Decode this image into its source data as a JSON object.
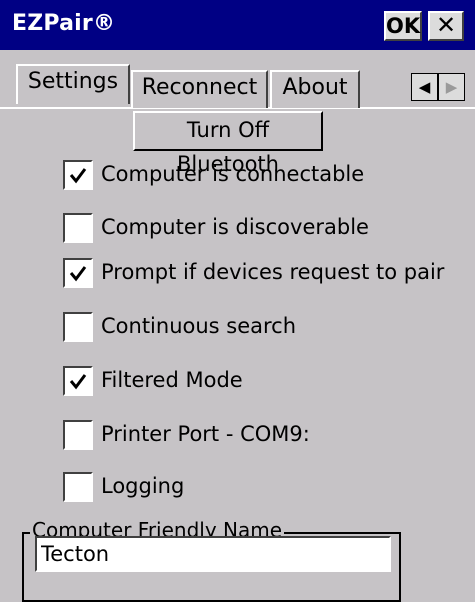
{
  "window": {
    "title": "EZPair®",
    "ok_label": "OK",
    "close_label": "✕"
  },
  "tabs": [
    {
      "label": "Settings",
      "active": true
    },
    {
      "label": "Reconnect",
      "active": false
    },
    {
      "label": "About",
      "active": false
    }
  ],
  "tab_scroll": {
    "left": "◀",
    "right": "▶"
  },
  "toggle_button": {
    "label": "Turn Off Bluetooth"
  },
  "options": [
    {
      "label": "Computer is connectable",
      "checked": true
    },
    {
      "label": "Computer is discoverable",
      "checked": false
    },
    {
      "label": "Prompt if devices request to pair",
      "checked": true
    },
    {
      "label": "Continuous search",
      "checked": false
    },
    {
      "label": "Filtered Mode",
      "checked": true
    },
    {
      "label": "Printer Port - COM9:",
      "checked": false
    },
    {
      "label": "Logging",
      "checked": false
    }
  ],
  "friendly_name": {
    "group_label": "Computer Friendly Name",
    "value": "Tecton"
  },
  "colors": {
    "titlebar": "#000084",
    "background": "#c6c3c6"
  }
}
